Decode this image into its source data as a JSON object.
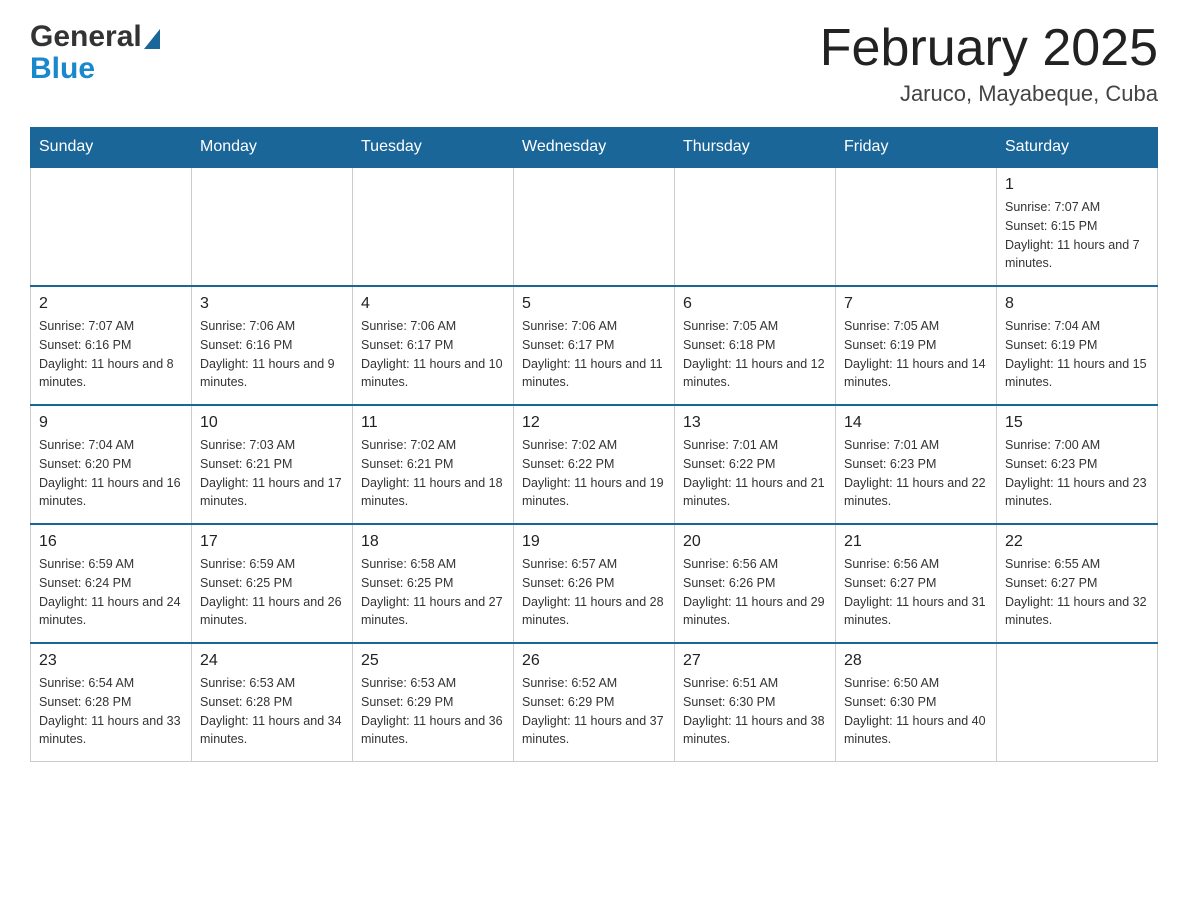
{
  "header": {
    "logo_general": "General",
    "logo_blue": "Blue",
    "title": "February 2025",
    "location": "Jaruco, Mayabeque, Cuba"
  },
  "weekdays": [
    "Sunday",
    "Monday",
    "Tuesday",
    "Wednesday",
    "Thursday",
    "Friday",
    "Saturday"
  ],
  "weeks": [
    [
      {
        "day": "",
        "sunrise": "",
        "sunset": "",
        "daylight": ""
      },
      {
        "day": "",
        "sunrise": "",
        "sunset": "",
        "daylight": ""
      },
      {
        "day": "",
        "sunrise": "",
        "sunset": "",
        "daylight": ""
      },
      {
        "day": "",
        "sunrise": "",
        "sunset": "",
        "daylight": ""
      },
      {
        "day": "",
        "sunrise": "",
        "sunset": "",
        "daylight": ""
      },
      {
        "day": "",
        "sunrise": "",
        "sunset": "",
        "daylight": ""
      },
      {
        "day": "1",
        "sunrise": "Sunrise: 7:07 AM",
        "sunset": "Sunset: 6:15 PM",
        "daylight": "Daylight: 11 hours and 7 minutes."
      }
    ],
    [
      {
        "day": "2",
        "sunrise": "Sunrise: 7:07 AM",
        "sunset": "Sunset: 6:16 PM",
        "daylight": "Daylight: 11 hours and 8 minutes."
      },
      {
        "day": "3",
        "sunrise": "Sunrise: 7:06 AM",
        "sunset": "Sunset: 6:16 PM",
        "daylight": "Daylight: 11 hours and 9 minutes."
      },
      {
        "day": "4",
        "sunrise": "Sunrise: 7:06 AM",
        "sunset": "Sunset: 6:17 PM",
        "daylight": "Daylight: 11 hours and 10 minutes."
      },
      {
        "day": "5",
        "sunrise": "Sunrise: 7:06 AM",
        "sunset": "Sunset: 6:17 PM",
        "daylight": "Daylight: 11 hours and 11 minutes."
      },
      {
        "day": "6",
        "sunrise": "Sunrise: 7:05 AM",
        "sunset": "Sunset: 6:18 PM",
        "daylight": "Daylight: 11 hours and 12 minutes."
      },
      {
        "day": "7",
        "sunrise": "Sunrise: 7:05 AM",
        "sunset": "Sunset: 6:19 PM",
        "daylight": "Daylight: 11 hours and 14 minutes."
      },
      {
        "day": "8",
        "sunrise": "Sunrise: 7:04 AM",
        "sunset": "Sunset: 6:19 PM",
        "daylight": "Daylight: 11 hours and 15 minutes."
      }
    ],
    [
      {
        "day": "9",
        "sunrise": "Sunrise: 7:04 AM",
        "sunset": "Sunset: 6:20 PM",
        "daylight": "Daylight: 11 hours and 16 minutes."
      },
      {
        "day": "10",
        "sunrise": "Sunrise: 7:03 AM",
        "sunset": "Sunset: 6:21 PM",
        "daylight": "Daylight: 11 hours and 17 minutes."
      },
      {
        "day": "11",
        "sunrise": "Sunrise: 7:02 AM",
        "sunset": "Sunset: 6:21 PM",
        "daylight": "Daylight: 11 hours and 18 minutes."
      },
      {
        "day": "12",
        "sunrise": "Sunrise: 7:02 AM",
        "sunset": "Sunset: 6:22 PM",
        "daylight": "Daylight: 11 hours and 19 minutes."
      },
      {
        "day": "13",
        "sunrise": "Sunrise: 7:01 AM",
        "sunset": "Sunset: 6:22 PM",
        "daylight": "Daylight: 11 hours and 21 minutes."
      },
      {
        "day": "14",
        "sunrise": "Sunrise: 7:01 AM",
        "sunset": "Sunset: 6:23 PM",
        "daylight": "Daylight: 11 hours and 22 minutes."
      },
      {
        "day": "15",
        "sunrise": "Sunrise: 7:00 AM",
        "sunset": "Sunset: 6:23 PM",
        "daylight": "Daylight: 11 hours and 23 minutes."
      }
    ],
    [
      {
        "day": "16",
        "sunrise": "Sunrise: 6:59 AM",
        "sunset": "Sunset: 6:24 PM",
        "daylight": "Daylight: 11 hours and 24 minutes."
      },
      {
        "day": "17",
        "sunrise": "Sunrise: 6:59 AM",
        "sunset": "Sunset: 6:25 PM",
        "daylight": "Daylight: 11 hours and 26 minutes."
      },
      {
        "day": "18",
        "sunrise": "Sunrise: 6:58 AM",
        "sunset": "Sunset: 6:25 PM",
        "daylight": "Daylight: 11 hours and 27 minutes."
      },
      {
        "day": "19",
        "sunrise": "Sunrise: 6:57 AM",
        "sunset": "Sunset: 6:26 PM",
        "daylight": "Daylight: 11 hours and 28 minutes."
      },
      {
        "day": "20",
        "sunrise": "Sunrise: 6:56 AM",
        "sunset": "Sunset: 6:26 PM",
        "daylight": "Daylight: 11 hours and 29 minutes."
      },
      {
        "day": "21",
        "sunrise": "Sunrise: 6:56 AM",
        "sunset": "Sunset: 6:27 PM",
        "daylight": "Daylight: 11 hours and 31 minutes."
      },
      {
        "day": "22",
        "sunrise": "Sunrise: 6:55 AM",
        "sunset": "Sunset: 6:27 PM",
        "daylight": "Daylight: 11 hours and 32 minutes."
      }
    ],
    [
      {
        "day": "23",
        "sunrise": "Sunrise: 6:54 AM",
        "sunset": "Sunset: 6:28 PM",
        "daylight": "Daylight: 11 hours and 33 minutes."
      },
      {
        "day": "24",
        "sunrise": "Sunrise: 6:53 AM",
        "sunset": "Sunset: 6:28 PM",
        "daylight": "Daylight: 11 hours and 34 minutes."
      },
      {
        "day": "25",
        "sunrise": "Sunrise: 6:53 AM",
        "sunset": "Sunset: 6:29 PM",
        "daylight": "Daylight: 11 hours and 36 minutes."
      },
      {
        "day": "26",
        "sunrise": "Sunrise: 6:52 AM",
        "sunset": "Sunset: 6:29 PM",
        "daylight": "Daylight: 11 hours and 37 minutes."
      },
      {
        "day": "27",
        "sunrise": "Sunrise: 6:51 AM",
        "sunset": "Sunset: 6:30 PM",
        "daylight": "Daylight: 11 hours and 38 minutes."
      },
      {
        "day": "28",
        "sunrise": "Sunrise: 6:50 AM",
        "sunset": "Sunset: 6:30 PM",
        "daylight": "Daylight: 11 hours and 40 minutes."
      },
      {
        "day": "",
        "sunrise": "",
        "sunset": "",
        "daylight": ""
      }
    ]
  ]
}
